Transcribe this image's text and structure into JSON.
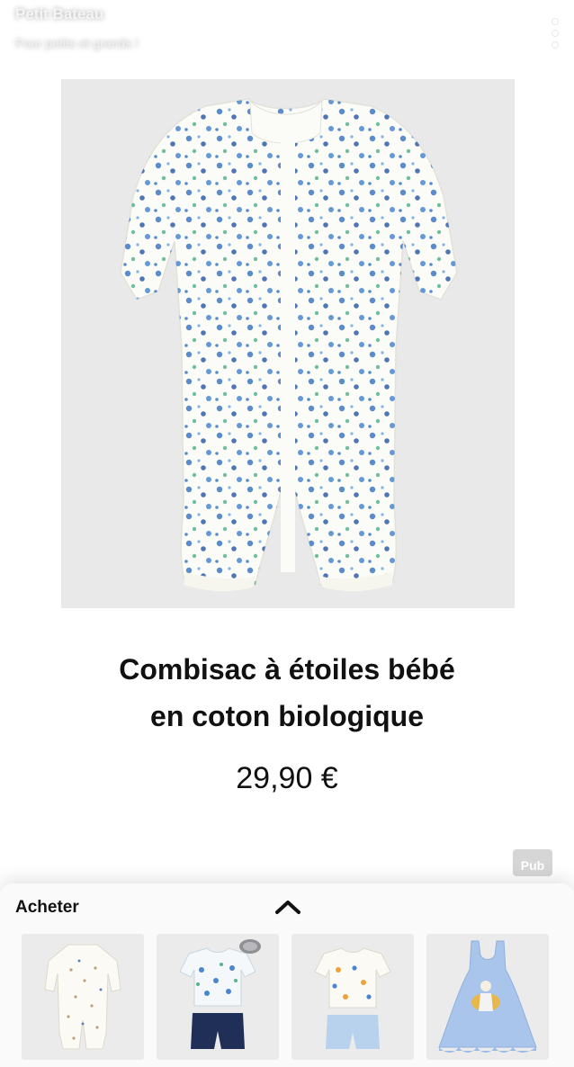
{
  "header": {
    "brand_name": "Petit Bateau",
    "tagline": "Pour petits et grands !",
    "menu_icon": "vertical-dots-menu-icon"
  },
  "product": {
    "image_alt": "Combisac à étoiles bébé - white baby sleepsuit with blue and green flower print",
    "title_line1": "Combisac à étoiles bébé",
    "title_line2": "en coton biologique",
    "price": "29,90 €"
  },
  "ad_badge": "Pub",
  "shop_panel": {
    "label": "Acheter",
    "chevron_icon": "chevron-up-icon",
    "thumbnails": [
      {
        "alt": "White baby sleepsuit with small polka dots"
      },
      {
        "alt": "Printed t-shirt and navy shorts pyjama set"
      },
      {
        "alt": "White printed t-shirt and light blue shorts pyjama set"
      },
      {
        "alt": "Light blue sleeveless dress with surfer print"
      }
    ]
  },
  "colors": {
    "background": "#ffffff",
    "image_bg": "#e9e9ea",
    "text": "#111111",
    "panel_bg": "#fafafa",
    "print_blue": "#3d78c4",
    "print_green": "#58b38a"
  }
}
